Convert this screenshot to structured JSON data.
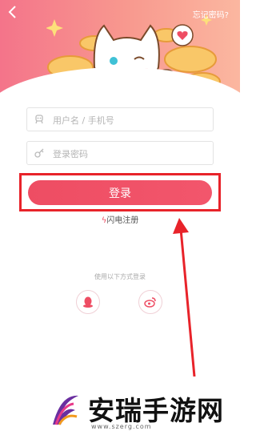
{
  "header": {
    "back_icon": "chevron-left-icon",
    "forgot_password": "忘记密码?"
  },
  "form": {
    "username_placeholder": "用户名 / 手机号",
    "username_icon": "user-icon",
    "password_placeholder": "登录密码",
    "password_icon": "key-icon",
    "login_label": "登录",
    "quick_register_label": "闪电注册",
    "quick_register_icon": "lightning-icon"
  },
  "social": {
    "title": "使用以下方式登录",
    "items": [
      {
        "icon": "qq-icon"
      },
      {
        "icon": "weibo-icon"
      }
    ]
  },
  "colors": {
    "accent": "#ee4d63",
    "highlight_box": "#e8232a",
    "arrow": "#e8232a"
  },
  "watermark": {
    "title": "安瑞手游网",
    "url": "www.szerg.com"
  }
}
